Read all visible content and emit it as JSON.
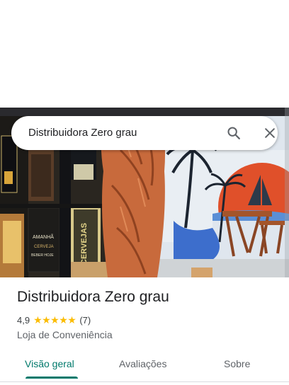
{
  "search": {
    "query": "Distribuidora Zero grau"
  },
  "place": {
    "name": "Distribuidora Zero grau",
    "rating": "4,9",
    "stars": "★★★★★",
    "review_count": "(7)",
    "category": "Loja de Conveniência"
  },
  "tabs": [
    {
      "label": "Visão geral",
      "active": true
    },
    {
      "label": "Avaliações",
      "active": false
    },
    {
      "label": "Sobre",
      "active": false
    }
  ],
  "photo_signs": {
    "sign_cervejas": "CERVEJAS",
    "sign_amanha": "AMANHÃ",
    "sign_cerveja": "CERVEJA",
    "sign_beber_hoje": "BEBER HOJE"
  },
  "colors": {
    "accent": "#00796b",
    "star": "#fbbc04",
    "wall_sunset": "#e0502a",
    "wall_blue": "#5b8fd6"
  }
}
